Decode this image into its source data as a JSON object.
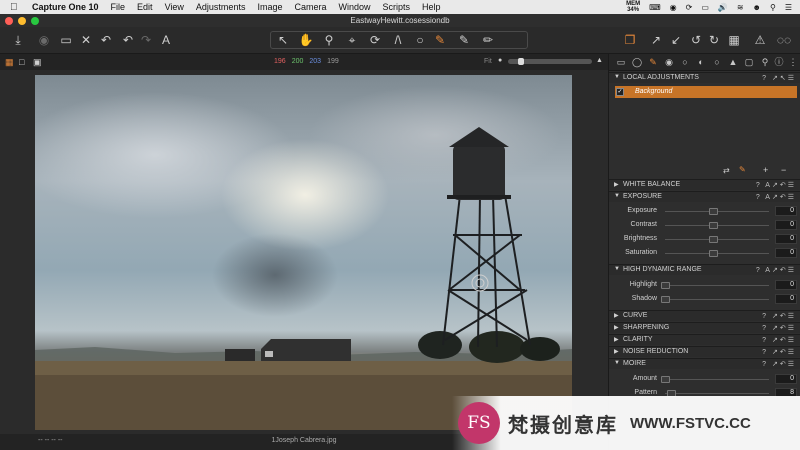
{
  "menubar": {
    "app": "Capture One 10",
    "items": [
      "File",
      "Edit",
      "View",
      "Adjustments",
      "Image",
      "Camera",
      "Window",
      "Scripts",
      "Help"
    ],
    "battery_label": "MEM",
    "battery_value": "34%"
  },
  "window": {
    "title": "EastwayHewitt.cosessiondb",
    "traffic_colors": [
      "#ff5f57",
      "#febc2e",
      "#28c840"
    ]
  },
  "viewer": {
    "rgb": [
      "196",
      "200",
      "203",
      "199"
    ],
    "rgb_colors": [
      "#e06060",
      "#6cc36c",
      "#6b8fe0",
      "#9a9a9a"
    ],
    "fit_label": "Fit",
    "filename": "1Joseph Cabrera.jpg",
    "bottom_left": "--   --   --   --"
  },
  "panel": {
    "local_adjustments_title": "LOCAL ADJUSTMENTS",
    "layer_name": "Background",
    "white_balance": "WHITE BALANCE",
    "exposure": {
      "title": "EXPOSURE",
      "rows": [
        {
          "label": "Exposure",
          "value": "0"
        },
        {
          "label": "Contrast",
          "value": "0"
        },
        {
          "label": "Brightness",
          "value": "0"
        },
        {
          "label": "Saturation",
          "value": "0"
        }
      ]
    },
    "hdr": {
      "title": "HIGH DYNAMIC RANGE",
      "rows": [
        {
          "label": "Highlight",
          "value": "0"
        },
        {
          "label": "Shadow",
          "value": "0"
        }
      ]
    },
    "curve": "CURVE",
    "sharpening": "SHARPENING",
    "clarity": "CLARITY",
    "noise_reduction": "NOISE REDUCTION",
    "moire": {
      "title": "MOIRE",
      "rows": [
        {
          "label": "Amount",
          "value": "0"
        },
        {
          "label": "Pattern",
          "value": "8"
        }
      ]
    }
  },
  "watermark": {
    "logo": "FS",
    "chinese": "梵摄创意库",
    "domain": "WWW.FSTVC.CC"
  }
}
